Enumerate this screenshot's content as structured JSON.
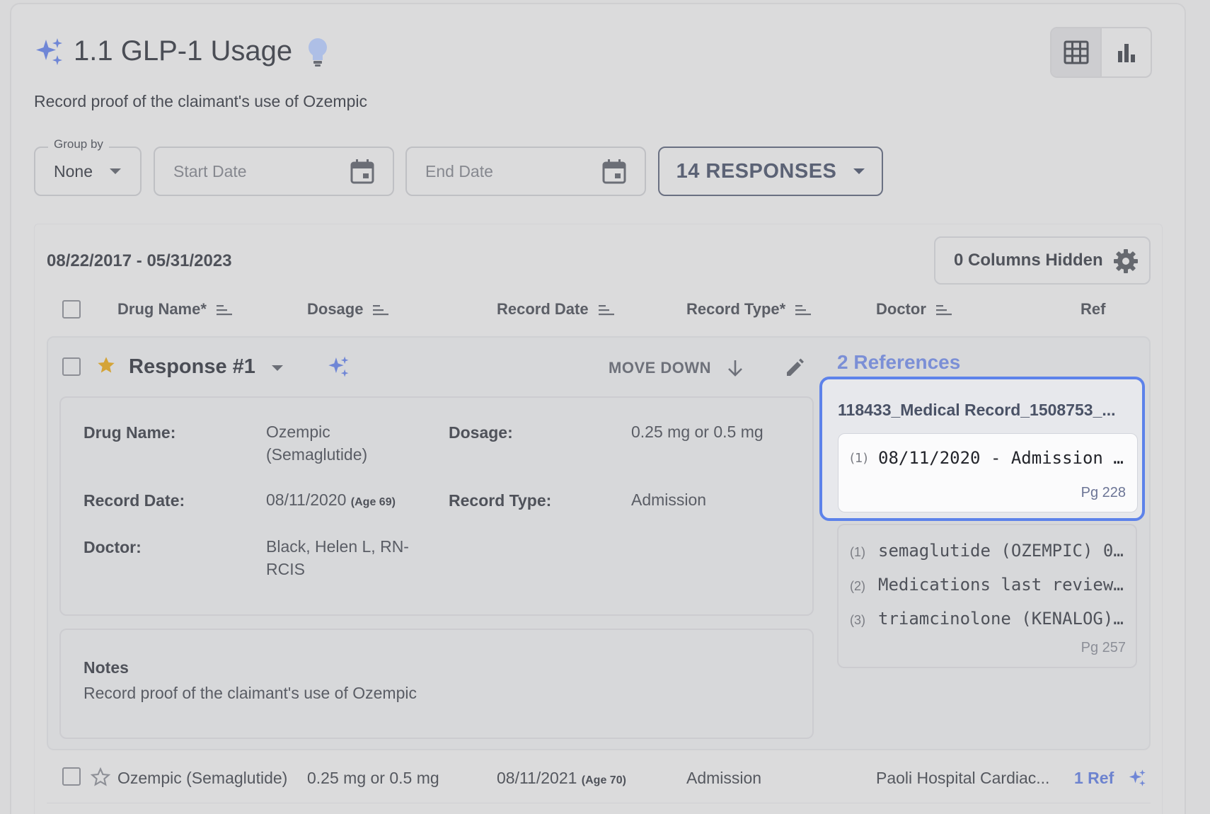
{
  "header": {
    "title": "1.1 GLP-1 Usage",
    "subtitle": "Record proof of the claimant's use of Ozempic"
  },
  "filters": {
    "group_by_label": "Group by",
    "group_by_value": "None",
    "start_date_placeholder": "Start Date",
    "end_date_placeholder": "End Date",
    "responses_label": "14 RESPONSES"
  },
  "table": {
    "date_range": "08/22/2017 - 05/31/2023",
    "columns_hidden": "0 Columns Hidden",
    "columns": [
      "Drug Name*",
      "Dosage",
      "Record Date",
      "Record Type*",
      "Doctor",
      "Ref"
    ]
  },
  "response1": {
    "title": "Response #1",
    "move_down": "MOVE DOWN",
    "labels": {
      "drug_name": "Drug Name:",
      "dosage": "Dosage:",
      "record_date": "Record Date:",
      "record_type": "Record Type:",
      "doctor": "Doctor:"
    },
    "drug_name_line1": "Ozempic",
    "drug_name_line2": "(Semaglutide)",
    "dosage": "0.25 mg or 0.5 mg",
    "record_date": "08/11/2020",
    "age": "(Age 69)",
    "record_type": "Admission",
    "doctor_line1": "Black, Helen L, RN-",
    "doctor_line2": "RCIS",
    "notes_title": "Notes",
    "notes_text": "Record proof of the claimant's use of Ozempic"
  },
  "references": {
    "title": "2 References",
    "active": {
      "file": "118433_Medical Record_1508753_...",
      "num": "(1)",
      "text": "08/11/2020 - Admission …",
      "page": "Pg 228"
    },
    "list": [
      {
        "num": "(1)",
        "text": "semaglutide (OZEMPIC) 0…"
      },
      {
        "num": "(2)",
        "text": "Medications last review…"
      },
      {
        "num": "(3)",
        "text": "triamcinolone (KENALOG)…"
      }
    ],
    "list_page": "Pg 257"
  },
  "row2": {
    "drug_name": "Ozempic (Semaglutide)",
    "dosage": "0.25 mg or 0.5 mg",
    "record_date": "08/11/2021",
    "age": "(Age 70)",
    "record_type": "Admission",
    "doctor": "Paoli Hospital Cardiac...",
    "ref": "1 Ref"
  },
  "colors": {
    "accent": "#5d82ea",
    "link": "#6d83cf",
    "star": "#d4a437",
    "sparkle": "#6f86d6"
  },
  "icons": [
    "sparkle-icon",
    "lightbulb-icon",
    "grid-view-icon",
    "bar-chart-icon",
    "calendar-icon",
    "gear-icon",
    "sort-icon",
    "star-icon",
    "arrow-down-icon",
    "pencil-icon",
    "chevron-down-icon"
  ]
}
